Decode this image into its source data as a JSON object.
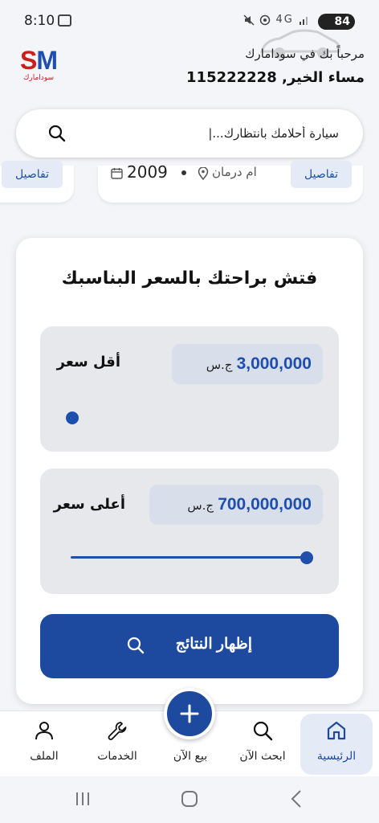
{
  "status_bar": {
    "time": "8:10",
    "signal_text": "4G",
    "battery": "84"
  },
  "header": {
    "logo_text": "SM",
    "logo_subtitle": "سودامارك",
    "welcome": "مرحباً بك في سودامارك",
    "greeting": "مساء الخير, 115222228"
  },
  "search": {
    "placeholder": "سيارة أحلامك بانتظارك...|"
  },
  "listing_strip": {
    "details_label": "تفاصيل",
    "location": "ام درمان",
    "year": "2009"
  },
  "price_filter": {
    "title": "فتش براحتك بالسعر البناسبك",
    "min_label": "أقل سعر",
    "min_value": "3,000,000",
    "max_label": "أعلى سعر",
    "max_value": "700,000,000",
    "currency": "ج.س",
    "min_slider_fraction": 0,
    "max_slider_fraction": 1,
    "show_results_label": "إظهار النتائج"
  },
  "bottom_nav": {
    "items": [
      {
        "label": "الرئيسية",
        "icon": "home-icon",
        "active": true
      },
      {
        "label": "ابحث الآن",
        "icon": "search-icon",
        "active": false
      },
      {
        "label": "بيع الآن",
        "icon": "plus-icon",
        "active": false
      },
      {
        "label": "الخدمات",
        "icon": "wrench-icon",
        "active": false
      },
      {
        "label": "الملف",
        "icon": "person-icon",
        "active": false
      }
    ]
  },
  "colors": {
    "primary": "#1d4a9e",
    "accent_red": "#c8201d",
    "active_bg": "#e4ebf7",
    "pill_bg": "#d8deea"
  }
}
